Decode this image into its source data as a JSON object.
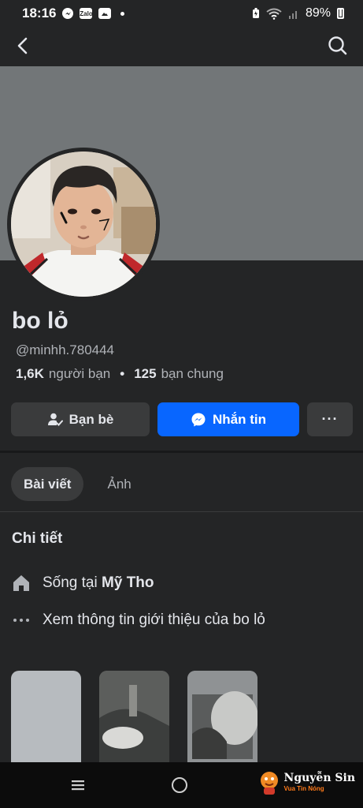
{
  "status_bar": {
    "time": "18:16",
    "notification_icons": [
      "messenger-icon",
      "zalo-icon",
      "gallery-icon"
    ],
    "zalo_label": "Zalo",
    "battery_percent": "89%"
  },
  "profile": {
    "name": "bo lỏ",
    "handle": "@minhh.780444",
    "friend_count": "1,6K",
    "friend_label": "người bạn",
    "mutual_count": "125",
    "mutual_label": "bạn chung"
  },
  "actions": {
    "friends_label": "Bạn bè",
    "message_label": "Nhắn tin",
    "more_label": "···"
  },
  "tabs": [
    {
      "label": "Bài viết",
      "active": true
    },
    {
      "label": "Ảnh",
      "active": false
    }
  ],
  "details": {
    "title": "Chi tiết",
    "lives_in_prefix": "Sống tại",
    "lives_in_place": "Mỹ Tho",
    "about_link": "Xem thông tin giới thiệu của bo lỏ"
  },
  "watermark": {
    "name": "Nguyễn Sin",
    "subtitle": "Vua Tin Nóng"
  },
  "colors": {
    "background": "#242526",
    "cover": "#727678",
    "primary_button": "#0866ff",
    "secondary_button": "#3a3b3c"
  }
}
